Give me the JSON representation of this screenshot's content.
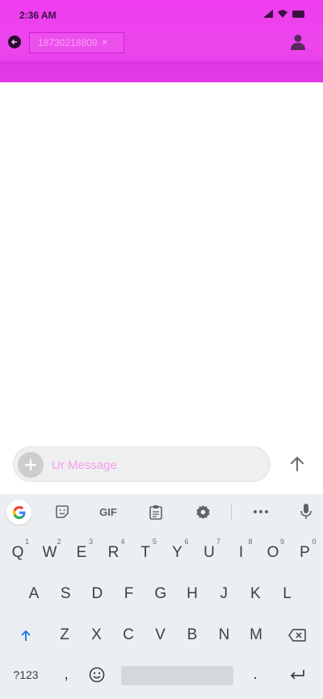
{
  "status_bar": {
    "time": "2:36 AM"
  },
  "header": {
    "recipient": "18730218809",
    "chip_close": "×"
  },
  "composer": {
    "placeholder": "Ur Message"
  },
  "keyboard": {
    "toolbar": {
      "gif_label": "GIF"
    },
    "row1": [
      {
        "key": "Q",
        "hint": "1"
      },
      {
        "key": "W",
        "hint": "2"
      },
      {
        "key": "E",
        "hint": "3"
      },
      {
        "key": "R",
        "hint": "4"
      },
      {
        "key": "T",
        "hint": "5"
      },
      {
        "key": "Y",
        "hint": "6"
      },
      {
        "key": "U",
        "hint": "7"
      },
      {
        "key": "I",
        "hint": "8"
      },
      {
        "key": "O",
        "hint": "9"
      },
      {
        "key": "P",
        "hint": "0"
      }
    ],
    "row2": [
      "A",
      "S",
      "D",
      "F",
      "G",
      "H",
      "J",
      "K",
      "L"
    ],
    "row3": [
      "Z",
      "X",
      "C",
      "V",
      "B",
      "N",
      "M"
    ],
    "row4": {
      "symbols": "?123",
      "comma": ",",
      "period": "."
    }
  },
  "colors": {
    "header_gradient_top": "#ee3cf0",
    "header_gradient_bottom": "#e23ae6",
    "placeholder": "#f49cf0",
    "shift_active": "#1a73e8",
    "keyboard_bg": "#eceff1"
  },
  "icons": {
    "back": "back-arrow-icon",
    "contact": "person-icon",
    "attach": "plus-icon",
    "send": "arrow-up-icon",
    "google": "google-g-icon",
    "sticker": "sticker-icon",
    "clipboard": "clipboard-icon",
    "settings": "gear-icon",
    "more": "more-dots-icon",
    "mic": "microphone-icon",
    "shift": "shift-arrow-icon",
    "backspace": "backspace-icon",
    "emoji": "emoji-icon",
    "enter": "enter-icon"
  }
}
